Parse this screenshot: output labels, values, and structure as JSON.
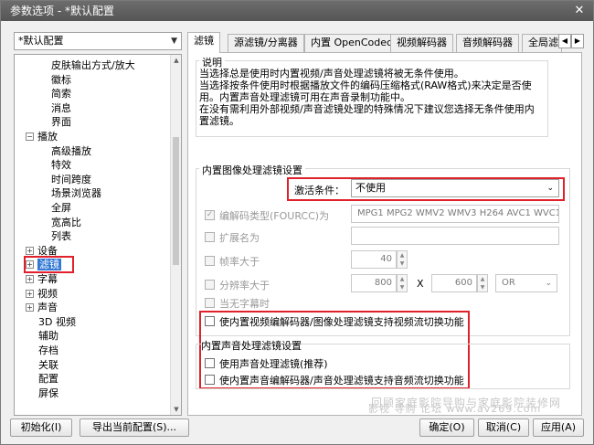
{
  "window": {
    "title": "参数选项 - *默认配置",
    "close": "✕"
  },
  "profile_combo": {
    "value": "*默认配置"
  },
  "tree": {
    "items": [
      {
        "label": "皮肤输出方式/放大",
        "indent": 3
      },
      {
        "label": "徽标",
        "indent": 3
      },
      {
        "label": "简索",
        "indent": 3
      },
      {
        "label": "消息",
        "indent": 3
      },
      {
        "label": "界面",
        "indent": 3
      },
      {
        "label": "播放",
        "indent": 1,
        "exp": "−"
      },
      {
        "label": "高级播放",
        "indent": 3
      },
      {
        "label": "特效",
        "indent": 3
      },
      {
        "label": "时间跨度",
        "indent": 3
      },
      {
        "label": "场景浏览器",
        "indent": 3
      },
      {
        "label": "全屏",
        "indent": 3
      },
      {
        "label": "宽高比",
        "indent": 3
      },
      {
        "label": "列表",
        "indent": 3
      },
      {
        "label": "设备",
        "indent": 1,
        "exp": "+"
      },
      {
        "label": "滤镜",
        "indent": 1,
        "exp": "+",
        "selected": true
      },
      {
        "label": "字幕",
        "indent": 1,
        "exp": "+"
      },
      {
        "label": "视频",
        "indent": 1,
        "exp": "+"
      },
      {
        "label": "声音",
        "indent": 1,
        "exp": "+"
      },
      {
        "label": "3D 视频",
        "indent": 2
      },
      {
        "label": "辅助",
        "indent": 2
      },
      {
        "label": "存档",
        "indent": 2
      },
      {
        "label": "关联",
        "indent": 2
      },
      {
        "label": "配置",
        "indent": 2
      },
      {
        "label": "屏保",
        "indent": 2
      }
    ]
  },
  "tabs": [
    "滤镜",
    "源滤镜/分离器",
    "内置 OpenCodec",
    "视频解码器",
    "音频解码器",
    "全局滤"
  ],
  "desc": {
    "title": "说明",
    "lines": [
      "当选择总是使用时内置视频/声音处理滤镜将被无条件使用。",
      "当选择按条件使用时根据播放文件的编码压缩格式(RAW格式)来决定是否使用。内置声音处理滤镜可用在声音录制功能中。",
      "在没有需利用外部视频/声音滤镜处理的特殊情况下建议您选择无条件使用内置滤镜。"
    ]
  },
  "video_group": {
    "title": "内置图像处理滤镜设置",
    "activate_label": "激活条件：",
    "activate_value": "不使用",
    "fourcc_label": "编解码类型(FOURCC)为",
    "fourcc_value": "MPG1 MPG2 WMV2 WMV3 H264 AVC1 WVC1",
    "ext_label": "扩展名为",
    "ext_value": "",
    "fps_label": "帧率大于",
    "fps_value": "40",
    "res_label": "分辨率大于",
    "res_w": "800",
    "res_x": "X",
    "res_h": "600",
    "res_op": "OR",
    "nosub_label": "当无字幕时",
    "switch_label": "使内置视频编解码器/图像处理滤镜支持视频流切换功能"
  },
  "audio_group": {
    "title": "内置声音处理滤镜设置",
    "use_label": "使用声音处理滤镜(推荐)",
    "switch_label": "使内置声音编解码器/声音处理滤镜支持音频流切换功能"
  },
  "buttons": {
    "init": "初始化(I)",
    "export": "导出当前配置(S)...",
    "ok": "确定(O)",
    "cancel": "取消(C)",
    "apply": "应用(A)"
  },
  "watermark": {
    "line1": "回顾家庭影院导购与家庭影院装修网",
    "line2": "影视 导购 论坛 www.av269.com"
  },
  "colors": {
    "highlight": "#e0202a",
    "selection": "#3278d4"
  }
}
